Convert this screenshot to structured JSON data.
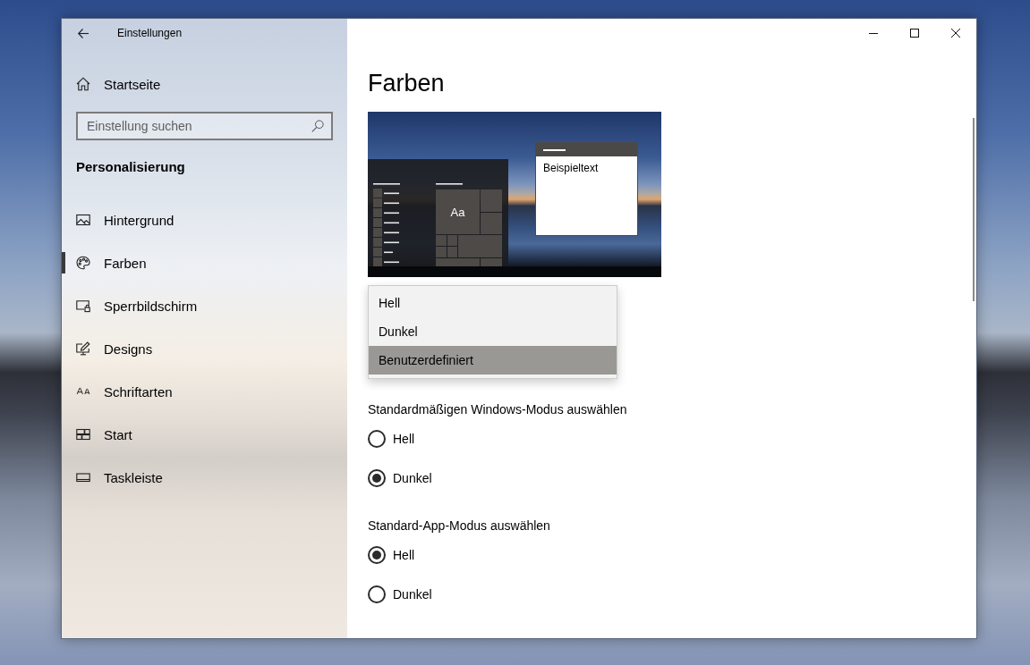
{
  "window": {
    "title": "Einstellungen"
  },
  "sidebar": {
    "home": "Startseite",
    "search": {
      "placeholder": "Einstellung suchen"
    },
    "section": "Personalisierung",
    "items": [
      {
        "label": "Hintergrund",
        "selected": false
      },
      {
        "label": "Farben",
        "selected": true
      },
      {
        "label": "Sperrbildschirm",
        "selected": false
      },
      {
        "label": "Designs",
        "selected": false
      },
      {
        "label": "Schriftarten",
        "selected": false
      },
      {
        "label": "Start",
        "selected": false
      },
      {
        "label": "Taskleiste",
        "selected": false
      }
    ]
  },
  "page": {
    "title": "Farben",
    "preview": {
      "sample_text": "Beispieltext",
      "tile_text": "Aa"
    },
    "color_menu": {
      "items": [
        {
          "label": "Hell",
          "selected": false
        },
        {
          "label": "Dunkel",
          "selected": false
        },
        {
          "label": "Benutzerdefiniert",
          "selected": true
        }
      ]
    },
    "groups": [
      {
        "heading": "Standardmäßigen Windows-Modus auswählen",
        "options": [
          {
            "label": "Hell",
            "selected": false
          },
          {
            "label": "Dunkel",
            "selected": true
          }
        ]
      },
      {
        "heading": "Standard-App-Modus auswählen",
        "options": [
          {
            "label": "Hell",
            "selected": true
          },
          {
            "label": "Dunkel",
            "selected": false
          }
        ]
      }
    ]
  }
}
